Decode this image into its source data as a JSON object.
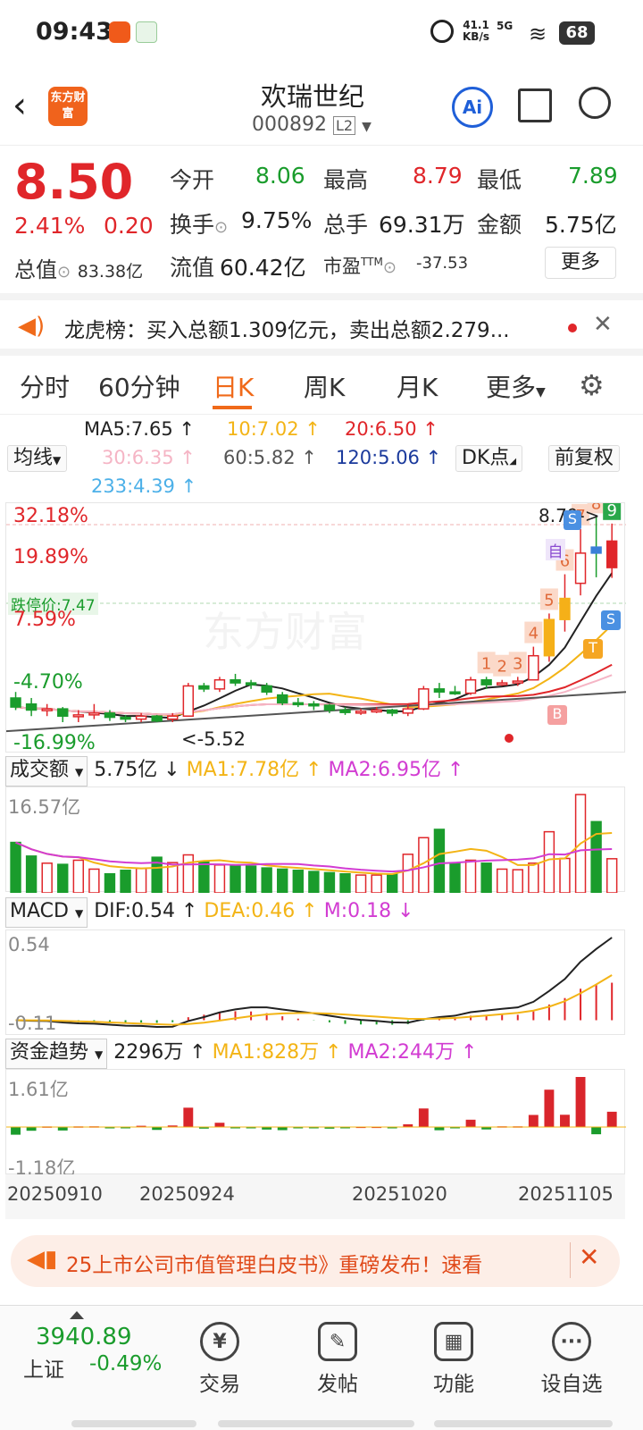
{
  "status": {
    "time": "09:43",
    "net_speed": "41.1",
    "net_unit": "KB/s",
    "signal": "5G",
    "battery": "68"
  },
  "header": {
    "title": "欢瑞世纪",
    "code": "000892",
    "level": "L2",
    "logo_text": "东方财富",
    "ai_label": "Ai"
  },
  "quote": {
    "price": "8.50",
    "pct": "2.41%",
    "change": "0.20",
    "open_label": "今开",
    "open": "8.06",
    "high_label": "最高",
    "high": "8.79",
    "low_label": "最低",
    "low": "7.89",
    "turnover_label": "换手",
    "turnover": "9.75%",
    "volume_label": "总手",
    "volume": "69.31万",
    "amount_label": "金额",
    "amount": "5.75亿",
    "mktcap_label": "总值",
    "mktcap": "83.38亿",
    "float_label": "流值",
    "float": "60.42亿",
    "pe_label": "市盈",
    "pe_sup": "TTM",
    "pe": "-37.53",
    "more_label": "更多"
  },
  "notice": {
    "text": "龙虎榜：买入总额1.309亿元，卖出总额2.279..."
  },
  "tabs": [
    {
      "label": "分时"
    },
    {
      "label": "60分钟"
    },
    {
      "label": "日K"
    },
    {
      "label": "周K"
    },
    {
      "label": "月K"
    },
    {
      "label": "更多"
    }
  ],
  "ma": {
    "ma5": "MA5:7.65 ↑",
    "ma10": "10:7.02 ↑",
    "ma20": "20:6.50 ↑",
    "ma30": "30:6.35 ↑",
    "ma60": "60:5.82 ↑",
    "ma120": "120:5.06 ↑",
    "ma233": "233:4.39 ↑",
    "selector": "均线",
    "dk": "DK点",
    "fq": "前复权"
  },
  "kline": {
    "pct_top": "32.18%",
    "pct_2": "19.89%",
    "pct_3": "7.59%",
    "pct_4": "-4.70%",
    "pct_bottom": "-16.99%",
    "limit_down": "跌停价:7.47",
    "high_marker": "8.79->",
    "low_marker": "<-5.52",
    "watermark": "东方财富",
    "seq_labels": [
      "1",
      "2",
      "3",
      "4",
      "5",
      "6",
      "7",
      "8",
      "9"
    ],
    "sig_buy": "B",
    "sig_sell": "S",
    "sig_self": "自",
    "sig_t": "T",
    "colors": {
      "up": "#e0262a",
      "down": "#1a9c2c",
      "ma5": "#222222",
      "ma10": "#f3b416",
      "ma20": "#e0262a",
      "ma30": "#f5b5c5",
      "ma60": "#555555",
      "ma120": "#1b3a9c",
      "ma233": "#4cb0e8"
    }
  },
  "volume": {
    "selector": "成交额",
    "value": "5.75亿 ↓",
    "ma1": "MA1:7.78亿 ↑",
    "ma2": "MA2:6.95亿 ↑",
    "top": "16.57亿"
  },
  "macd": {
    "selector": "MACD",
    "dif": "DIF:0.54 ↑",
    "dea": "DEA:0.46 ↑",
    "m": "M:0.18 ↓",
    "top": "0.54",
    "bottom": "-0.11"
  },
  "fund": {
    "selector": "资金趋势",
    "value": "2296万 ↑",
    "ma1": "MA1:828万 ↑",
    "ma2": "MA2:244万 ↑",
    "top": "1.61亿",
    "bottom": "-1.18亿"
  },
  "dates": [
    "20250910",
    "20250924",
    "20251020",
    "20251105"
  ],
  "ad": {
    "text": "25上市公司市值管理白皮书》重磅发布！速看"
  },
  "bottom": {
    "index_value": "3940.89",
    "index_name": "上证",
    "index_pct": "-0.49%",
    "nav": [
      {
        "label": "交易",
        "icon": "¥"
      },
      {
        "label": "发帖",
        "icon": "✎"
      },
      {
        "label": "功能",
        "icon": "▦"
      },
      {
        "label": "设自选",
        "icon": "···"
      }
    ]
  },
  "chart_data": {
    "type": "candlestick",
    "candles": [
      [
        5.9,
        5.75,
        6.0,
        5.7
      ],
      [
        5.8,
        5.7,
        5.9,
        5.6
      ],
      [
        5.7,
        5.72,
        5.8,
        5.6
      ],
      [
        5.72,
        5.6,
        5.75,
        5.5
      ],
      [
        5.6,
        5.62,
        5.7,
        5.5
      ],
      [
        5.62,
        5.65,
        5.8,
        5.55
      ],
      [
        5.65,
        5.58,
        5.7,
        5.52
      ],
      [
        5.58,
        5.56,
        5.62,
        5.5
      ],
      [
        5.55,
        5.6,
        5.65,
        5.5
      ],
      [
        5.6,
        5.52,
        5.62,
        5.5
      ],
      [
        5.55,
        5.6,
        5.65,
        5.5
      ],
      [
        5.6,
        6.1,
        6.15,
        5.6
      ],
      [
        6.1,
        6.05,
        6.15,
        6.0
      ],
      [
        6.05,
        6.2,
        6.25,
        6.0
      ],
      [
        6.2,
        6.15,
        6.3,
        6.1
      ],
      [
        6.15,
        6.12,
        6.2,
        6.05
      ],
      [
        6.1,
        6.0,
        6.15,
        5.95
      ],
      [
        5.95,
        5.82,
        6.0,
        5.78
      ],
      [
        5.82,
        5.8,
        5.9,
        5.75
      ],
      [
        5.8,
        5.78,
        5.85,
        5.7
      ],
      [
        5.78,
        5.7,
        5.8,
        5.65
      ],
      [
        5.7,
        5.66,
        5.75,
        5.62
      ],
      [
        5.66,
        5.68,
        5.72,
        5.62
      ],
      [
        5.68,
        5.7,
        5.75,
        5.65
      ],
      [
        5.7,
        5.65,
        5.72,
        5.6
      ],
      [
        5.65,
        5.72,
        5.8,
        5.6
      ],
      [
        5.72,
        6.05,
        6.1,
        5.7
      ],
      [
        6.05,
        6.0,
        6.15,
        5.9
      ],
      [
        6.0,
        5.98,
        6.1,
        5.95
      ],
      [
        5.98,
        6.2,
        6.25,
        5.95
      ],
      [
        6.2,
        6.12,
        6.25,
        6.05
      ],
      [
        6.12,
        6.15,
        6.2,
        6.1
      ],
      [
        6.15,
        6.18,
        6.25,
        6.1
      ],
      [
        6.2,
        6.6,
        6.75,
        6.2
      ],
      [
        6.6,
        7.2,
        7.3,
        6.5
      ],
      [
        7.2,
        7.55,
        7.95,
        7.0
      ],
      [
        7.8,
        8.3,
        8.7,
        7.6
      ],
      [
        8.4,
        8.3,
        8.9,
        7.9
      ],
      [
        8.06,
        8.5,
        8.79,
        7.89
      ]
    ],
    "volume": [
      8.5,
      6.2,
      5.0,
      4.8,
      5.5,
      4.0,
      3.2,
      3.8,
      4.1,
      6.0,
      5.1,
      6.4,
      5.3,
      4.7,
      4.5,
      4.5,
      4.2,
      4.0,
      3.8,
      3.6,
      3.4,
      3.2,
      3.0,
      3.0,
      3.2,
      6.5,
      9.3,
      10.7,
      5.0,
      5.5,
      5.0,
      4.0,
      3.9,
      5.0,
      10.3,
      5.8,
      16.57,
      12.0,
      5.75
    ],
    "dates": [
      "20250910",
      "20250924",
      "20251020",
      "20251105"
    ]
  }
}
